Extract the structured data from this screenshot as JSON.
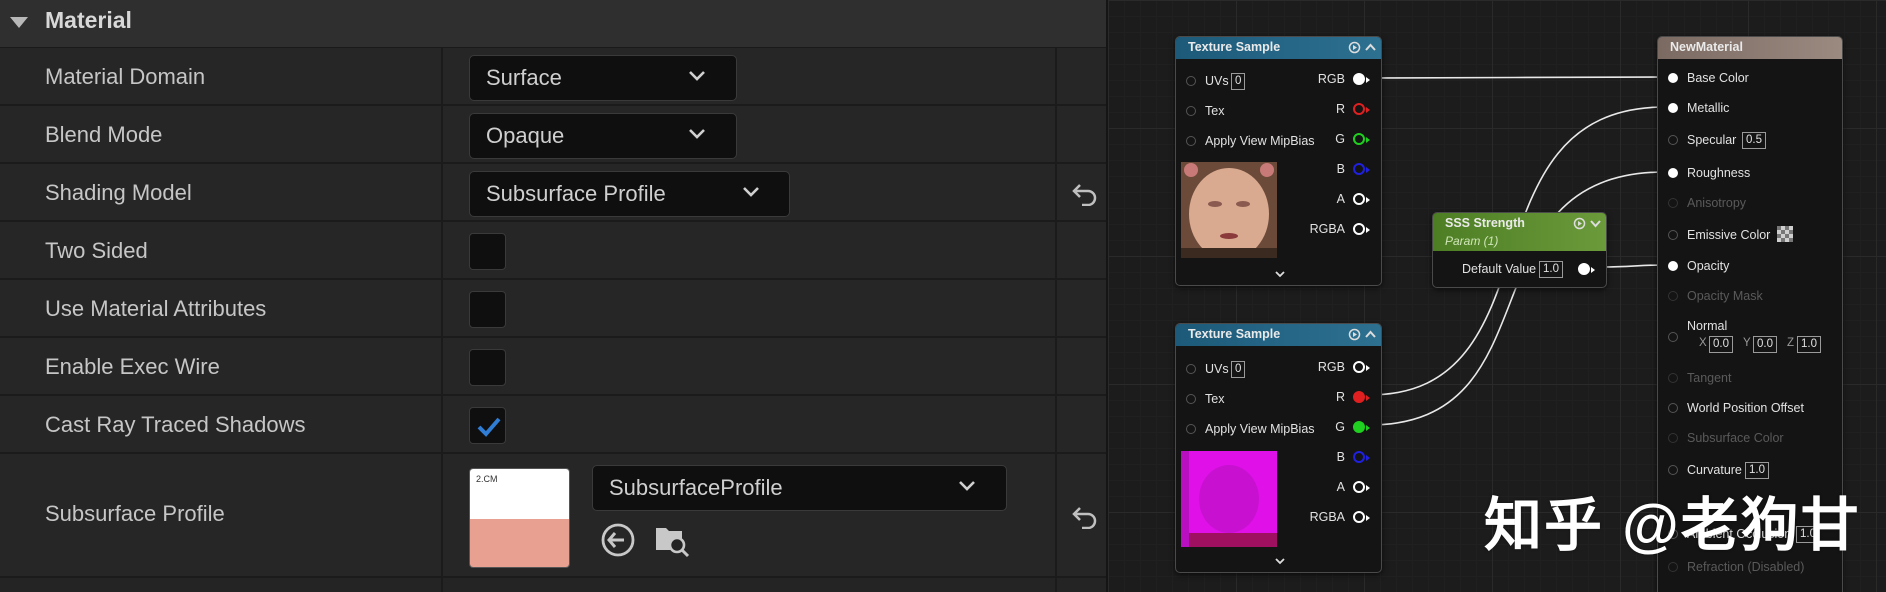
{
  "details": {
    "section_title": "Material",
    "properties": [
      {
        "label": "Material Domain",
        "value": "Surface"
      },
      {
        "label": "Blend Mode",
        "value": "Opaque"
      },
      {
        "label": "Shading Model",
        "value": "Subsurface Profile"
      },
      {
        "label": "Two Sided",
        "checked": false
      },
      {
        "label": "Use Material Attributes",
        "checked": false
      },
      {
        "label": "Enable Exec Wire",
        "checked": false
      },
      {
        "label": "Cast Ray Traced Shadows",
        "checked": true
      },
      {
        "label": "Subsurface Profile",
        "value": "SubsurfaceProfile",
        "thumb_label": "2.CM"
      }
    ],
    "icons": {
      "reset": "reset-to-default-icon",
      "use_selected": "use-selected-icon",
      "browse": "browse-asset-icon",
      "checkmark": "checkmark-icon"
    },
    "colors": {
      "checkmark": "#2f7dd4",
      "profile_swatch": "#e8a090"
    }
  },
  "graph": {
    "texture_sample_1": {
      "title": "Texture Sample",
      "inputs": [
        "UVs",
        "Tex",
        "Apply View MipBias"
      ],
      "uvs_value": "0",
      "outputs": [
        "RGB",
        "R",
        "G",
        "B",
        "A",
        "RGBA"
      ],
      "header_color": "#1d5a7a"
    },
    "texture_sample_2": {
      "title": "Texture Sample",
      "inputs": [
        "UVs",
        "Tex",
        "Apply View MipBias"
      ],
      "uvs_value": "0",
      "outputs": [
        "RGB",
        "R",
        "G",
        "B",
        "A",
        "RGBA"
      ],
      "header_color": "#1d5a7a"
    },
    "sss_strength": {
      "title": "SSS Strength",
      "subtitle": "Param (1)",
      "input_label": "Default Value",
      "input_value": "1.0",
      "header_color": "#5a8a2a"
    },
    "new_material": {
      "title": "NewMaterial",
      "header_color": "#8a7a70",
      "pins": [
        {
          "label": "Base Color",
          "connected": true,
          "enabled": true
        },
        {
          "label": "Metallic",
          "connected": true,
          "enabled": true
        },
        {
          "label": "Specular",
          "value": "0.5",
          "enabled": true
        },
        {
          "label": "Roughness",
          "connected": true,
          "enabled": true
        },
        {
          "label": "Anisotropy",
          "enabled": false
        },
        {
          "label": "Emissive Color",
          "enabled": true
        },
        {
          "label": "Opacity",
          "connected": true,
          "enabled": true
        },
        {
          "label": "Opacity Mask",
          "enabled": false
        },
        {
          "label": "Normal",
          "enabled": true
        },
        {
          "label": "Tangent",
          "enabled": false
        },
        {
          "label": "World Position Offset",
          "enabled": true
        },
        {
          "label": "Subsurface Color",
          "enabled": false
        },
        {
          "label": "Curvature",
          "value": "1.0",
          "enabled": true
        },
        {
          "label": "Ambient Occlusion",
          "value": "1.0",
          "enabled": true
        },
        {
          "label": "Refraction (Disabled)",
          "enabled": false
        }
      ],
      "normal_values": {
        "x_label": "X",
        "x": "0.0",
        "y_label": "Y",
        "y": "0.0",
        "z_label": "Z",
        "z": "1.0"
      }
    },
    "channel_colors": {
      "r": "#e02020",
      "g": "#20d020",
      "b": "#2020e0"
    }
  },
  "watermark": "知乎 @老狗甘"
}
